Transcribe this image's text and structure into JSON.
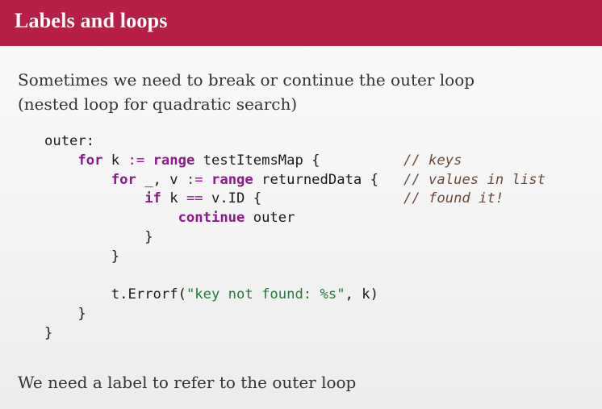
{
  "slide": {
    "title": "Labels and loops",
    "intro_lines": [
      "Sometimes we need to break or continue the outer loop",
      "(nested loop for quadratic search)"
    ],
    "code": {
      "l1": {
        "label": "outer:"
      },
      "l2": {
        "kw_for": "for",
        "vars": " k ",
        "op": ":=",
        "kw_range": "range",
        "rest": " testItemsMap {",
        "comment": "// keys"
      },
      "l3": {
        "kw_for": "for",
        "vars": " _, v ",
        "op": ":=",
        "kw_range": "range",
        "rest": " returnedData {",
        "comment": "// values in list"
      },
      "l4": {
        "kw_if": "if",
        "cond_a": " k ",
        "op": "==",
        "cond_b": " v.ID {",
        "comment": "// found it!"
      },
      "l5": {
        "kw_continue": "continue",
        "target": " outer"
      },
      "l6": {
        "text": "}"
      },
      "l7": {
        "text": "}"
      },
      "l9": {
        "call": "t.Errorf(",
        "str": "\"key not found: %s\"",
        "end": ", k)"
      },
      "l10": {
        "text": "}"
      },
      "l11": {
        "text": "}"
      }
    },
    "footer": "We need a label to refer to the outer loop"
  }
}
